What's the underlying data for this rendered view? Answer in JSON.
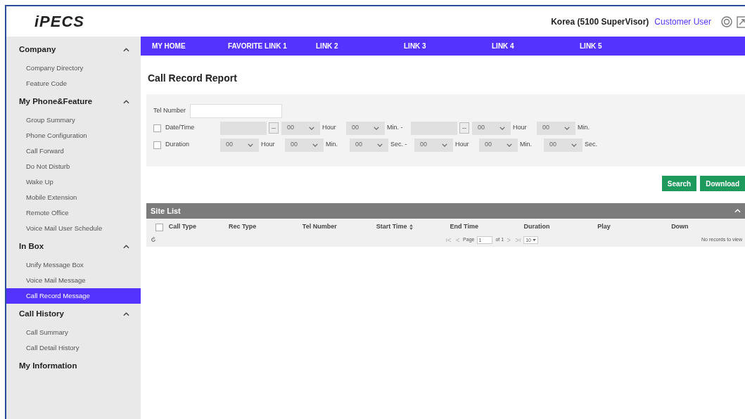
{
  "header": {
    "logo": "iPECS",
    "site": "Korea (5100 SuperVisor)",
    "user": "Customer User"
  },
  "nav": [
    {
      "label": "MY HOME"
    },
    {
      "label": "FAVORITE LINK 1"
    },
    {
      "label": "LINK 2"
    },
    {
      "label": "LINK 3"
    },
    {
      "label": "LINK 4"
    },
    {
      "label": "LINK 5"
    }
  ],
  "sidebar": {
    "sections": [
      {
        "title": "Company",
        "expanded": true,
        "items": [
          {
            "label": "Company Directory",
            "selected": false
          },
          {
            "label": "Feature Code",
            "selected": false
          }
        ]
      },
      {
        "title": "My Phone&Feature",
        "expanded": true,
        "items": [
          {
            "label": "Group Summary",
            "selected": false
          },
          {
            "label": "Phone Configuration",
            "selected": false
          },
          {
            "label": "Call Forward",
            "selected": false
          },
          {
            "label": "Do Not Disturb",
            "selected": false
          },
          {
            "label": "Wake Up",
            "selected": false
          },
          {
            "label": "Mobile Extension",
            "selected": false
          },
          {
            "label": "Remote Office",
            "selected": false
          },
          {
            "label": "Voice Mail User Schedule",
            "selected": false
          }
        ]
      },
      {
        "title": "In Box",
        "expanded": true,
        "items": [
          {
            "label": "Unify Message Box",
            "selected": false
          },
          {
            "label": "Voice Mail Message",
            "selected": false
          },
          {
            "label": "Call Record Message",
            "selected": true
          }
        ]
      },
      {
        "title": "Call History",
        "expanded": true,
        "items": [
          {
            "label": "Call Summary",
            "selected": false
          },
          {
            "label": "Call Detail History",
            "selected": false
          }
        ]
      },
      {
        "title": "My Information",
        "expanded": false
      }
    ]
  },
  "page_title": "Call Record Report",
  "filters": {
    "tel_number": {
      "label": "Tel Number"
    },
    "rows": [
      {
        "label": "Date/Time",
        "checked": false,
        "fields": [
          {
            "kind": "date"
          },
          {
            "kind": "select",
            "value": "00",
            "unit": "Hour"
          },
          {
            "kind": "select",
            "value": "00",
            "unit": "Min. -"
          },
          {
            "kind": "date"
          },
          {
            "kind": "select",
            "value": "00",
            "unit": "Hour"
          },
          {
            "kind": "select",
            "value": "00",
            "unit": "Min."
          }
        ]
      },
      {
        "label": "Duration",
        "checked": false,
        "fields": [
          {
            "kind": "select",
            "value": "00",
            "unit": "Hour"
          },
          {
            "kind": "select",
            "value": "00",
            "unit": "Min."
          },
          {
            "kind": "select",
            "value": "00",
            "unit": "Sec. -"
          },
          {
            "kind": "select",
            "value": "00",
            "unit": "Hour"
          },
          {
            "kind": "select",
            "value": "00",
            "unit": "Min."
          },
          {
            "kind": "select",
            "value": "00",
            "unit": "Sec."
          }
        ]
      }
    ]
  },
  "buttons": [
    "Search",
    "Download"
  ],
  "grid": {
    "title": "Site List",
    "expanded": true,
    "select_all_checked": false,
    "columns": [
      {
        "label": "Call Type",
        "sortable": false
      },
      {
        "label": "Rec Type",
        "sortable": false
      },
      {
        "label": "Tel Number",
        "sortable": false
      },
      {
        "label": "Start Time",
        "sortable": true
      },
      {
        "label": "End Time",
        "sortable": false
      },
      {
        "label": "Duration",
        "sortable": false
      },
      {
        "label": "Play",
        "sortable": false
      },
      {
        "label": "Down",
        "sortable": false
      }
    ],
    "pager": {
      "page_label": "Page",
      "page": "1",
      "of": "of 1",
      "rows": "10"
    },
    "empty_text": "No records to view"
  }
}
